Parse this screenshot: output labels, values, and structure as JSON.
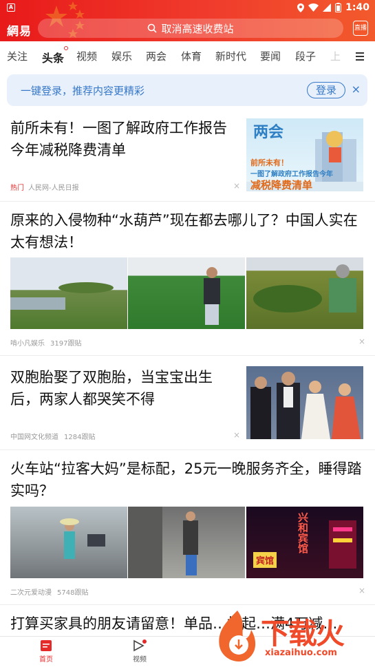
{
  "status": {
    "sim_label": "A",
    "time": "1:40"
  },
  "header": {
    "logo": "網易",
    "search_placeholder": "取消高速收费站",
    "live_label": "直播"
  },
  "tabs": [
    {
      "label": "关注"
    },
    {
      "label": "头条"
    },
    {
      "label": "视频"
    },
    {
      "label": "娱乐"
    },
    {
      "label": "两会"
    },
    {
      "label": "体育"
    },
    {
      "label": "新时代"
    },
    {
      "label": "要闻"
    },
    {
      "label": "段子"
    },
    {
      "label": "上"
    }
  ],
  "login_banner": {
    "text": "一键登录，推荐内容更精彩",
    "button": "登录",
    "close": "×"
  },
  "articles": [
    {
      "title": "前所未有！一图了解政府工作报告今年减税降费清单",
      "tag": "热门",
      "source": "人民网-人民日报",
      "comments": "",
      "thumb_text": {
        "big": "两会",
        "line1": "前所未有！",
        "line2": "一图了解政府工作报告今年",
        "line3": "减税降费清单"
      }
    },
    {
      "title": "原来的入侵物种“水葫芦”现在都去哪儿了？中国人实在太有想法！",
      "tag": "",
      "source": "啃小凡娱乐",
      "comments": "3197跟贴"
    },
    {
      "title": "双胞胎娶了双胞胎，当宝宝出生后，两家人都哭笑不得",
      "tag": "",
      "source": "中国网文化频道",
      "comments": "1284跟贴"
    },
    {
      "title": "火车站“拉客大妈”是标配，25元一晚服务齐全，睡得踏实吗？",
      "tag": "",
      "source": "二次元爱动漫",
      "comments": "5748跟贴",
      "sign_text": {
        "a": "兴和宾馆",
        "b": "宾馆"
      }
    },
    {
      "title": "打算买家具的朋友请留意！单品…折起…满4万减…",
      "tag": "",
      "source": "",
      "comments": ""
    }
  ],
  "bottom_nav": [
    {
      "label": "首页"
    },
    {
      "label": "视频"
    }
  ],
  "watermark": {
    "text": "下载火",
    "url": "xiazaihuo.com"
  },
  "colors": {
    "brand_red": "#e81a1a",
    "login_blue": "#3778c9",
    "hot_red": "#e52a2a"
  }
}
